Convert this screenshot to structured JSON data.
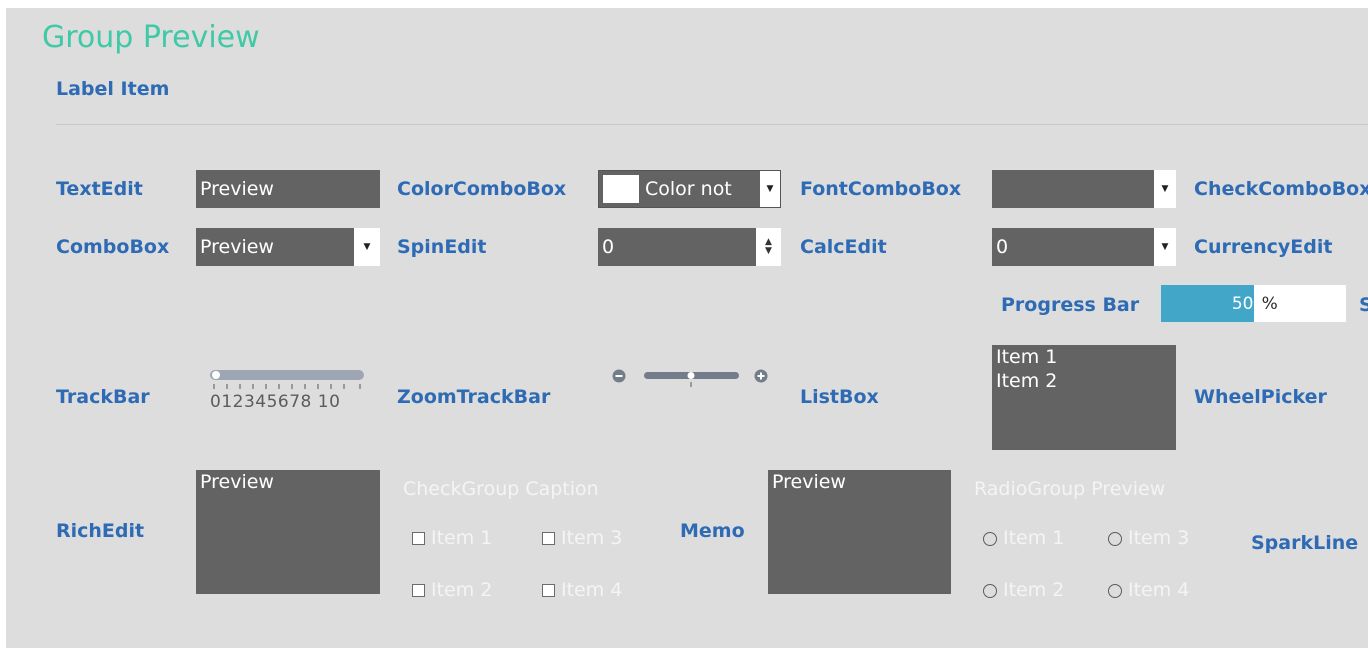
{
  "group": {
    "title": "Group Preview",
    "label_item": "Label Item"
  },
  "row1": {
    "textedit": {
      "label": "TextEdit",
      "value": "Preview"
    },
    "colorcombo": {
      "label": "ColorComboBox",
      "value": "Color not"
    },
    "fontcombo": {
      "label": "FontComboBox",
      "value": ""
    },
    "checkcombo": {
      "label": "CheckComboBox"
    }
  },
  "row2": {
    "combobox": {
      "label": "ComboBox",
      "value": "Preview"
    },
    "spinedit": {
      "label": "SpinEdit",
      "value": "0"
    },
    "calcedit": {
      "label": "CalcEdit",
      "value": "0"
    },
    "currencyedit": {
      "label": "CurrencyEdit"
    }
  },
  "progress": {
    "label": "Progress Bar",
    "value_text": "50",
    "unit": "%",
    "fraction": 0.5,
    "trailing_letter": "S"
  },
  "row4": {
    "trackbar": {
      "label": "TrackBar",
      "scale": "012345678 10"
    },
    "zoomtrackbar": {
      "label": "ZoomTrackBar"
    },
    "listbox": {
      "label": "ListBox",
      "items": [
        "Item 1",
        "Item 2"
      ]
    },
    "wheelpicker": {
      "label": "WheelPicker"
    }
  },
  "row5": {
    "richedit": {
      "label": "RichEdit",
      "value": "Preview"
    },
    "checkgroup": {
      "caption": "CheckGroup Caption",
      "items": [
        "Item 1",
        "Item 2",
        "Item 3",
        "Item 4"
      ]
    },
    "memo": {
      "label": "Memo",
      "value": "Preview"
    },
    "radiogroup": {
      "caption": "RadioGroup Preview",
      "items": [
        "Item 1",
        "Item 2",
        "Item 3",
        "Item 4"
      ]
    },
    "sparkline": {
      "label": "SparkLine"
    }
  },
  "icons": {
    "dropdown": "triangle-down",
    "spin": "updown-arrows",
    "zoom_out": "minus-circle",
    "zoom_in": "plus-circle"
  },
  "colors": {
    "title": "#3ec9a7",
    "label": "#2e6bb4",
    "field_bg": "#636363",
    "progress_fill": "#42a6c8",
    "background": "#dddddd"
  }
}
